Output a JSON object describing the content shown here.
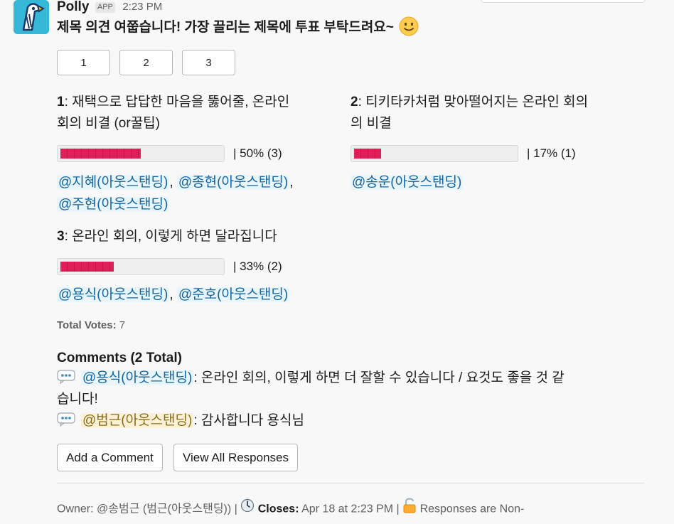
{
  "app": {
    "sender": "Polly",
    "badge": "APP",
    "time": "2:23 PM",
    "title": "제목 의견 여쭙습니다! 가장 끌리는 제목에 투표 부탁드려요~",
    "title_emoji": "slightly-smiling-face-icon"
  },
  "vote_buttons": [
    "1",
    "2",
    "3"
  ],
  "options": [
    {
      "number": "1",
      "text_line1": ": 재택으로 답답한 마음을 뚫어줄, 온라인",
      "text_line2": "회의 비결 (or꿀팁)",
      "percent_label": "|  50% (3)",
      "fraction": 0.5,
      "voters": [
        "@지혜(아웃스탠딩)",
        "@종현(아웃스탠딩)",
        "@주현(아웃스탠딩)"
      ],
      "sep": ","
    },
    {
      "number": "2",
      "text_line1": ": 티키타카처럼 맞아떨어지는 온라인 회의",
      "text_line2": "의 비결",
      "percent_label": "|  17% (1)",
      "fraction": 0.17,
      "voters": [
        "@송운(아웃스탠딩)"
      ]
    },
    {
      "number": "3",
      "text_line1": ": 온라인 회의, 이렇게 하면 달라집니다",
      "percent_label": "|  33% (2)",
      "fraction": 0.33,
      "voters": [
        "@용식(아웃스탠딩)",
        "@준호(아웃스탠딩)"
      ],
      "sep": ","
    }
  ],
  "total": {
    "label": "Total Votes:",
    "value": "7"
  },
  "comments": {
    "heading": "Comments (2 Total)",
    "items": [
      {
        "author": "@용식(아웃스탠딩)",
        "line1": ": 온라인 회의, 이렇게 하면 더 잘할 수 있습니다 / 요것도 좋을 것 같",
        "line2": "습니다!"
      },
      {
        "author": "@범근(아웃스탠딩)",
        "line1": ": 감사합니다 용식님"
      }
    ]
  },
  "actions": {
    "add_comment": "Add a Comment",
    "view_all": "View All Responses"
  },
  "footer": {
    "owner_label": "Owner: @송범근 (범근(아웃스탠딩))",
    "sep1": "|",
    "closes_label": "Closes:",
    "closes_value": "Apr 18 at 2:23 PM",
    "sep2": "|",
    "responses_label": "Responses are Non-"
  },
  "colors": {
    "bar_fill": "#e01e5a",
    "mention_text": "#1264a3",
    "mention_bg": "#e8f5fa",
    "self_mention_bg": "#fcf1d7"
  }
}
